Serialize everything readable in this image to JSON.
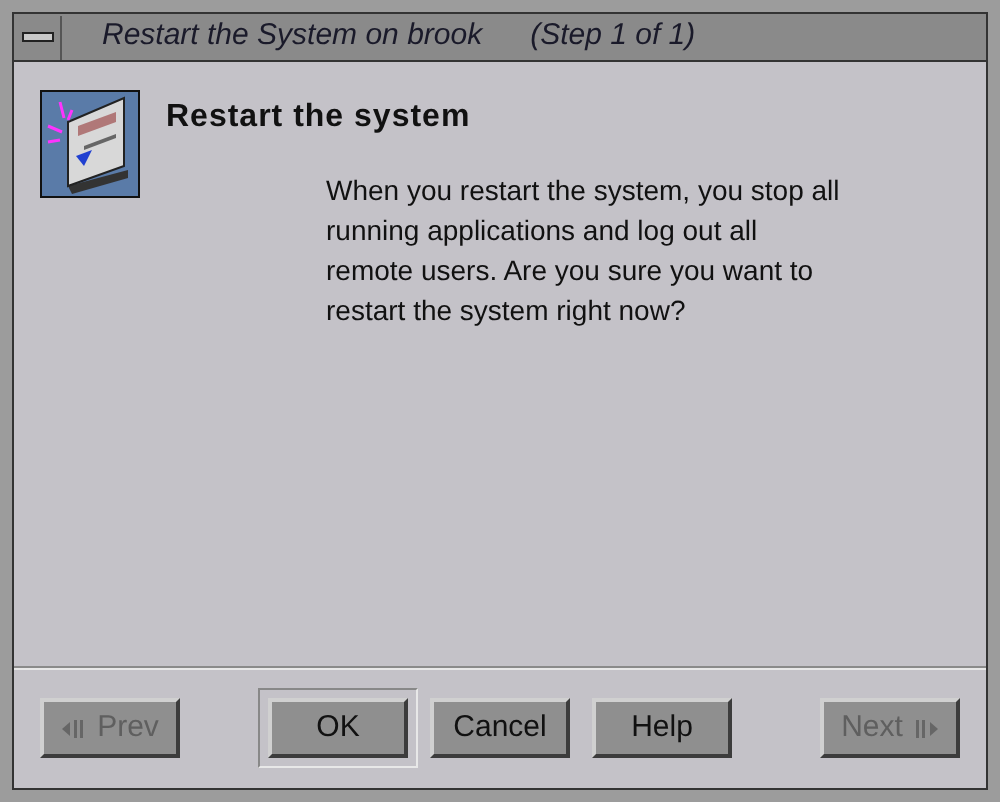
{
  "window": {
    "title": "Restart the System on brook",
    "step": "(Step 1 of 1)"
  },
  "heading": "Restart the system",
  "message": "When you restart the system, you stop all running applications and log out all remote users. Are you sure you want to restart the system right now?",
  "buttons": [
    {
      "label": "Prev",
      "kind": "prev",
      "disabled": true,
      "default": false
    },
    {
      "label": "OK",
      "kind": "action",
      "disabled": false,
      "default": true
    },
    {
      "label": "Cancel",
      "kind": "action",
      "disabled": false,
      "default": false
    },
    {
      "label": "Help",
      "kind": "action",
      "disabled": false,
      "default": false
    },
    {
      "label": "Next",
      "kind": "next",
      "disabled": true,
      "default": false
    }
  ]
}
